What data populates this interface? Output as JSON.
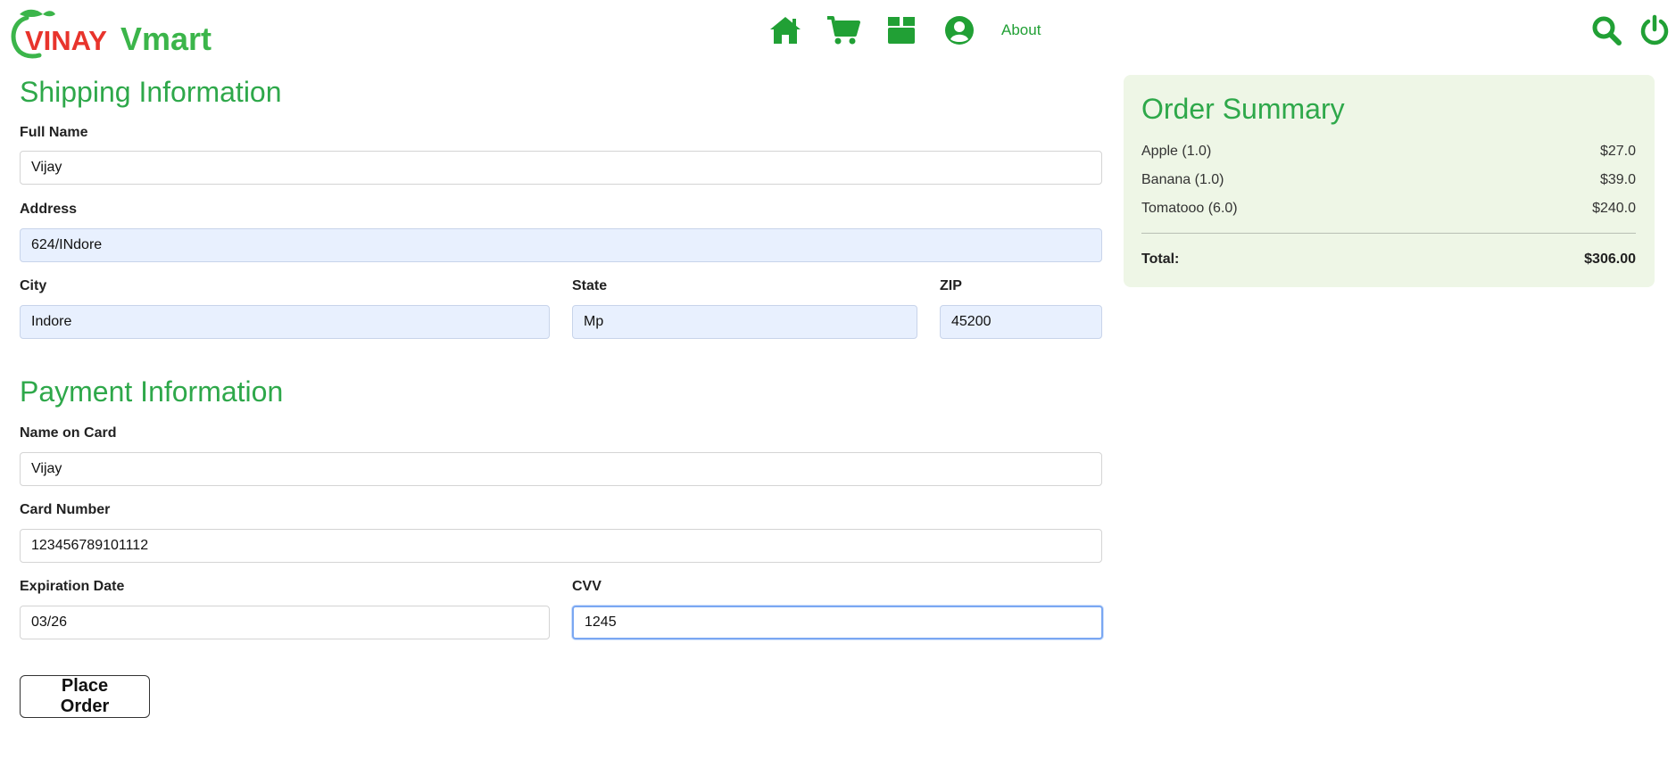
{
  "brand": {
    "logo_text_1": "VINAY",
    "logo_text_2": "Vmart",
    "accent": "#21a035"
  },
  "nav": {
    "items": [
      {
        "icon": "home-icon"
      },
      {
        "icon": "cart-icon"
      },
      {
        "icon": "box-icon"
      },
      {
        "icon": "user-icon"
      }
    ],
    "about_label": "About",
    "search_icon": "search-icon",
    "power_icon": "power-icon"
  },
  "shipping": {
    "title": "Shipping Information",
    "full_name": {
      "label": "Full Name",
      "value": "Vijay"
    },
    "address": {
      "label": "Address",
      "value": "624/INdore"
    },
    "city": {
      "label": "City",
      "value": "Indore"
    },
    "state": {
      "label": "State",
      "value": "Mp"
    },
    "zip": {
      "label": "ZIP",
      "value": "45200"
    }
  },
  "payment": {
    "title": "Payment Information",
    "name_on_card": {
      "label": "Name on Card",
      "value": "Vijay"
    },
    "card_number": {
      "label": "Card Number",
      "value": "123456789101112"
    },
    "expiration": {
      "label": "Expiration Date",
      "value": "03/26"
    },
    "cvv": {
      "label": "CVV",
      "value": "1245"
    }
  },
  "place_order_label": "Place Order",
  "summary": {
    "title": "Order Summary",
    "items": [
      {
        "name": "Apple (1.0)",
        "price": "$27.0"
      },
      {
        "name": "Banana (1.0)",
        "price": "$39.0"
      },
      {
        "name": "Tomatooo (6.0)",
        "price": "$240.0"
      }
    ],
    "total_label": "Total:",
    "total_value": "$306.00"
  }
}
